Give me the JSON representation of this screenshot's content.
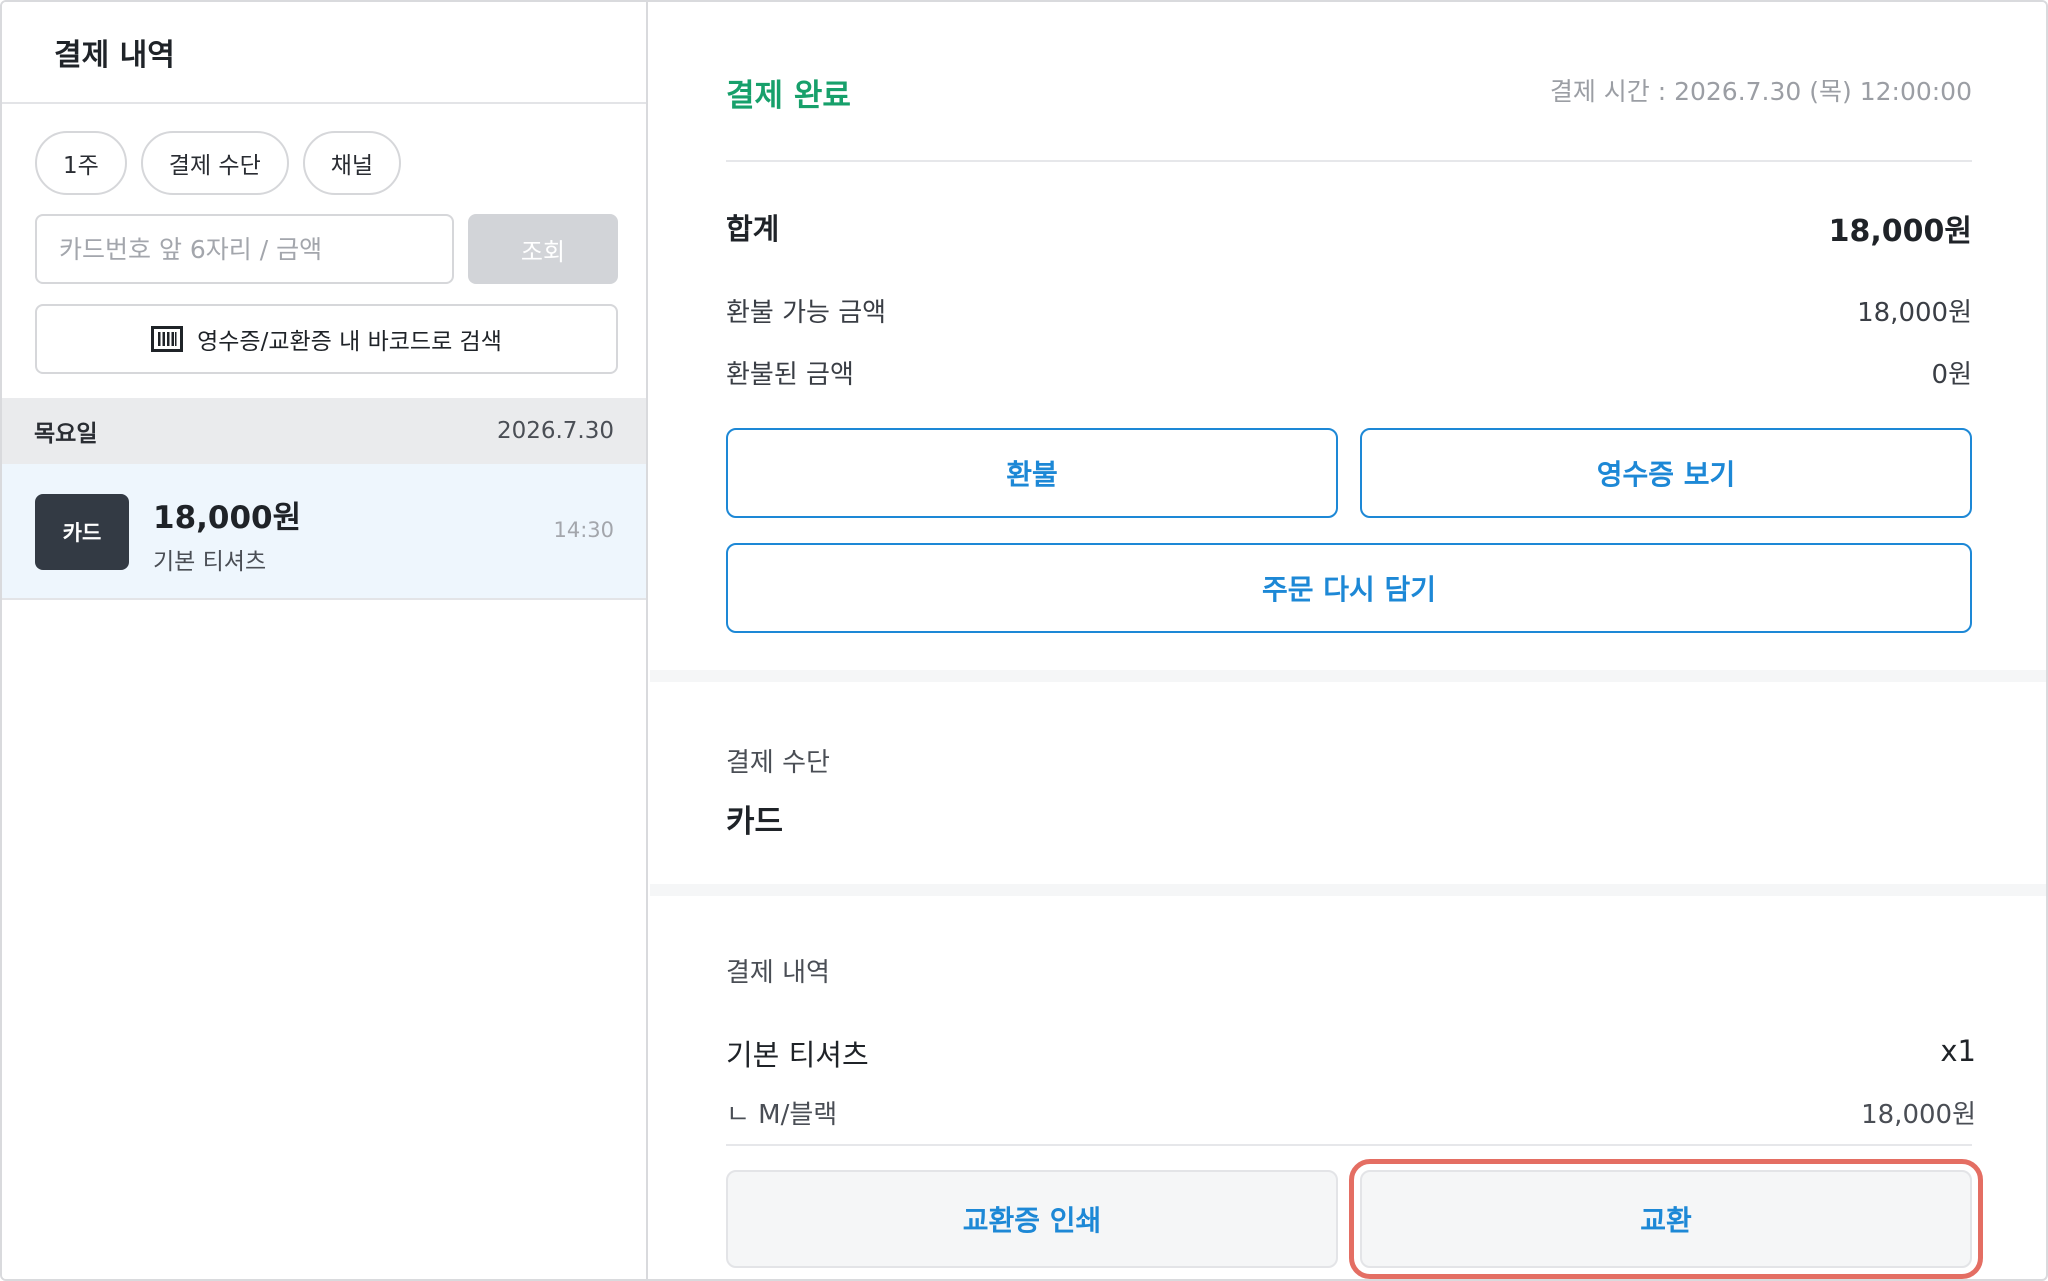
{
  "left": {
    "title": "결제 내역",
    "chips": [
      "1주",
      "결제 수단",
      "채널"
    ],
    "search": {
      "placeholder": "카드번호 앞 6자리 / 금액",
      "button": "조회"
    },
    "barcode_button": "영수증/교환증 내 바코드로 검색",
    "day": {
      "name": "목요일",
      "date": "2026.7.30"
    },
    "payment": {
      "badge": "카드",
      "amount": "18,000원",
      "item": "기본 티셔츠",
      "time": "14:30"
    }
  },
  "right": {
    "status": "결제 완료",
    "pay_time": "결제 시간 : 2026.7.30 (목) 12:00:00",
    "total_label": "합계",
    "total_value": "18,000원",
    "refundable_label": "환불 가능 금액",
    "refundable_value": "18,000원",
    "refunded_label": "환불된 금액",
    "refunded_value": "0원",
    "buttons": {
      "refund": "환불",
      "view_receipt": "영수증 보기",
      "reorder": "주문 다시 담기"
    },
    "method_label": "결제 수단",
    "method_value": "카드",
    "history_label": "결제 내역",
    "item": {
      "name": "기본 티셔츠",
      "qty": "x1",
      "option": "ㄴ  M/블랙",
      "price": "18,000원"
    },
    "bottom_buttons": {
      "print_exchange": "교환증 인쇄",
      "exchange": "교환"
    }
  },
  "colors": {
    "status_green": "#17a06b",
    "accent_blue": "#1d88d6",
    "highlight": "#e46e63"
  }
}
